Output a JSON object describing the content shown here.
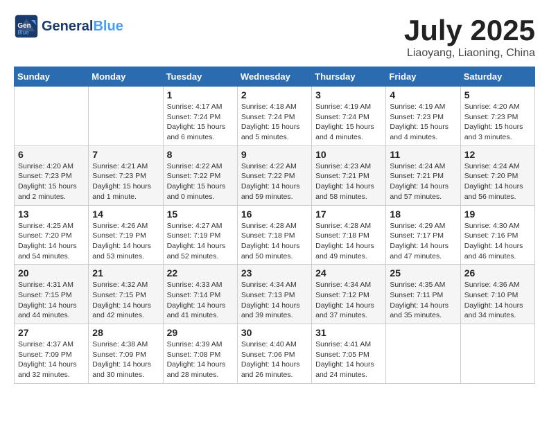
{
  "header": {
    "logo_line1": "General",
    "logo_line2": "Blue",
    "month_title": "July 2025",
    "subtitle": "Liaoyang, Liaoning, China"
  },
  "weekdays": [
    "Sunday",
    "Monday",
    "Tuesday",
    "Wednesday",
    "Thursday",
    "Friday",
    "Saturday"
  ],
  "weeks": [
    [
      {
        "day": "",
        "info": ""
      },
      {
        "day": "",
        "info": ""
      },
      {
        "day": "1",
        "info": "Sunrise: 4:17 AM\nSunset: 7:24 PM\nDaylight: 15 hours\nand 6 minutes."
      },
      {
        "day": "2",
        "info": "Sunrise: 4:18 AM\nSunset: 7:24 PM\nDaylight: 15 hours\nand 5 minutes."
      },
      {
        "day": "3",
        "info": "Sunrise: 4:19 AM\nSunset: 7:24 PM\nDaylight: 15 hours\nand 4 minutes."
      },
      {
        "day": "4",
        "info": "Sunrise: 4:19 AM\nSunset: 7:23 PM\nDaylight: 15 hours\nand 4 minutes."
      },
      {
        "day": "5",
        "info": "Sunrise: 4:20 AM\nSunset: 7:23 PM\nDaylight: 15 hours\nand 3 minutes."
      }
    ],
    [
      {
        "day": "6",
        "info": "Sunrise: 4:20 AM\nSunset: 7:23 PM\nDaylight: 15 hours\nand 2 minutes."
      },
      {
        "day": "7",
        "info": "Sunrise: 4:21 AM\nSunset: 7:23 PM\nDaylight: 15 hours\nand 1 minute."
      },
      {
        "day": "8",
        "info": "Sunrise: 4:22 AM\nSunset: 7:22 PM\nDaylight: 15 hours\nand 0 minutes."
      },
      {
        "day": "9",
        "info": "Sunrise: 4:22 AM\nSunset: 7:22 PM\nDaylight: 14 hours\nand 59 minutes."
      },
      {
        "day": "10",
        "info": "Sunrise: 4:23 AM\nSunset: 7:21 PM\nDaylight: 14 hours\nand 58 minutes."
      },
      {
        "day": "11",
        "info": "Sunrise: 4:24 AM\nSunset: 7:21 PM\nDaylight: 14 hours\nand 57 minutes."
      },
      {
        "day": "12",
        "info": "Sunrise: 4:24 AM\nSunset: 7:20 PM\nDaylight: 14 hours\nand 56 minutes."
      }
    ],
    [
      {
        "day": "13",
        "info": "Sunrise: 4:25 AM\nSunset: 7:20 PM\nDaylight: 14 hours\nand 54 minutes."
      },
      {
        "day": "14",
        "info": "Sunrise: 4:26 AM\nSunset: 7:19 PM\nDaylight: 14 hours\nand 53 minutes."
      },
      {
        "day": "15",
        "info": "Sunrise: 4:27 AM\nSunset: 7:19 PM\nDaylight: 14 hours\nand 52 minutes."
      },
      {
        "day": "16",
        "info": "Sunrise: 4:28 AM\nSunset: 7:18 PM\nDaylight: 14 hours\nand 50 minutes."
      },
      {
        "day": "17",
        "info": "Sunrise: 4:28 AM\nSunset: 7:18 PM\nDaylight: 14 hours\nand 49 minutes."
      },
      {
        "day": "18",
        "info": "Sunrise: 4:29 AM\nSunset: 7:17 PM\nDaylight: 14 hours\nand 47 minutes."
      },
      {
        "day": "19",
        "info": "Sunrise: 4:30 AM\nSunset: 7:16 PM\nDaylight: 14 hours\nand 46 minutes."
      }
    ],
    [
      {
        "day": "20",
        "info": "Sunrise: 4:31 AM\nSunset: 7:15 PM\nDaylight: 14 hours\nand 44 minutes."
      },
      {
        "day": "21",
        "info": "Sunrise: 4:32 AM\nSunset: 7:15 PM\nDaylight: 14 hours\nand 42 minutes."
      },
      {
        "day": "22",
        "info": "Sunrise: 4:33 AM\nSunset: 7:14 PM\nDaylight: 14 hours\nand 41 minutes."
      },
      {
        "day": "23",
        "info": "Sunrise: 4:34 AM\nSunset: 7:13 PM\nDaylight: 14 hours\nand 39 minutes."
      },
      {
        "day": "24",
        "info": "Sunrise: 4:34 AM\nSunset: 7:12 PM\nDaylight: 14 hours\nand 37 minutes."
      },
      {
        "day": "25",
        "info": "Sunrise: 4:35 AM\nSunset: 7:11 PM\nDaylight: 14 hours\nand 35 minutes."
      },
      {
        "day": "26",
        "info": "Sunrise: 4:36 AM\nSunset: 7:10 PM\nDaylight: 14 hours\nand 34 minutes."
      }
    ],
    [
      {
        "day": "27",
        "info": "Sunrise: 4:37 AM\nSunset: 7:09 PM\nDaylight: 14 hours\nand 32 minutes."
      },
      {
        "day": "28",
        "info": "Sunrise: 4:38 AM\nSunset: 7:09 PM\nDaylight: 14 hours\nand 30 minutes."
      },
      {
        "day": "29",
        "info": "Sunrise: 4:39 AM\nSunset: 7:08 PM\nDaylight: 14 hours\nand 28 minutes."
      },
      {
        "day": "30",
        "info": "Sunrise: 4:40 AM\nSunset: 7:06 PM\nDaylight: 14 hours\nand 26 minutes."
      },
      {
        "day": "31",
        "info": "Sunrise: 4:41 AM\nSunset: 7:05 PM\nDaylight: 14 hours\nand 24 minutes."
      },
      {
        "day": "",
        "info": ""
      },
      {
        "day": "",
        "info": ""
      }
    ]
  ]
}
